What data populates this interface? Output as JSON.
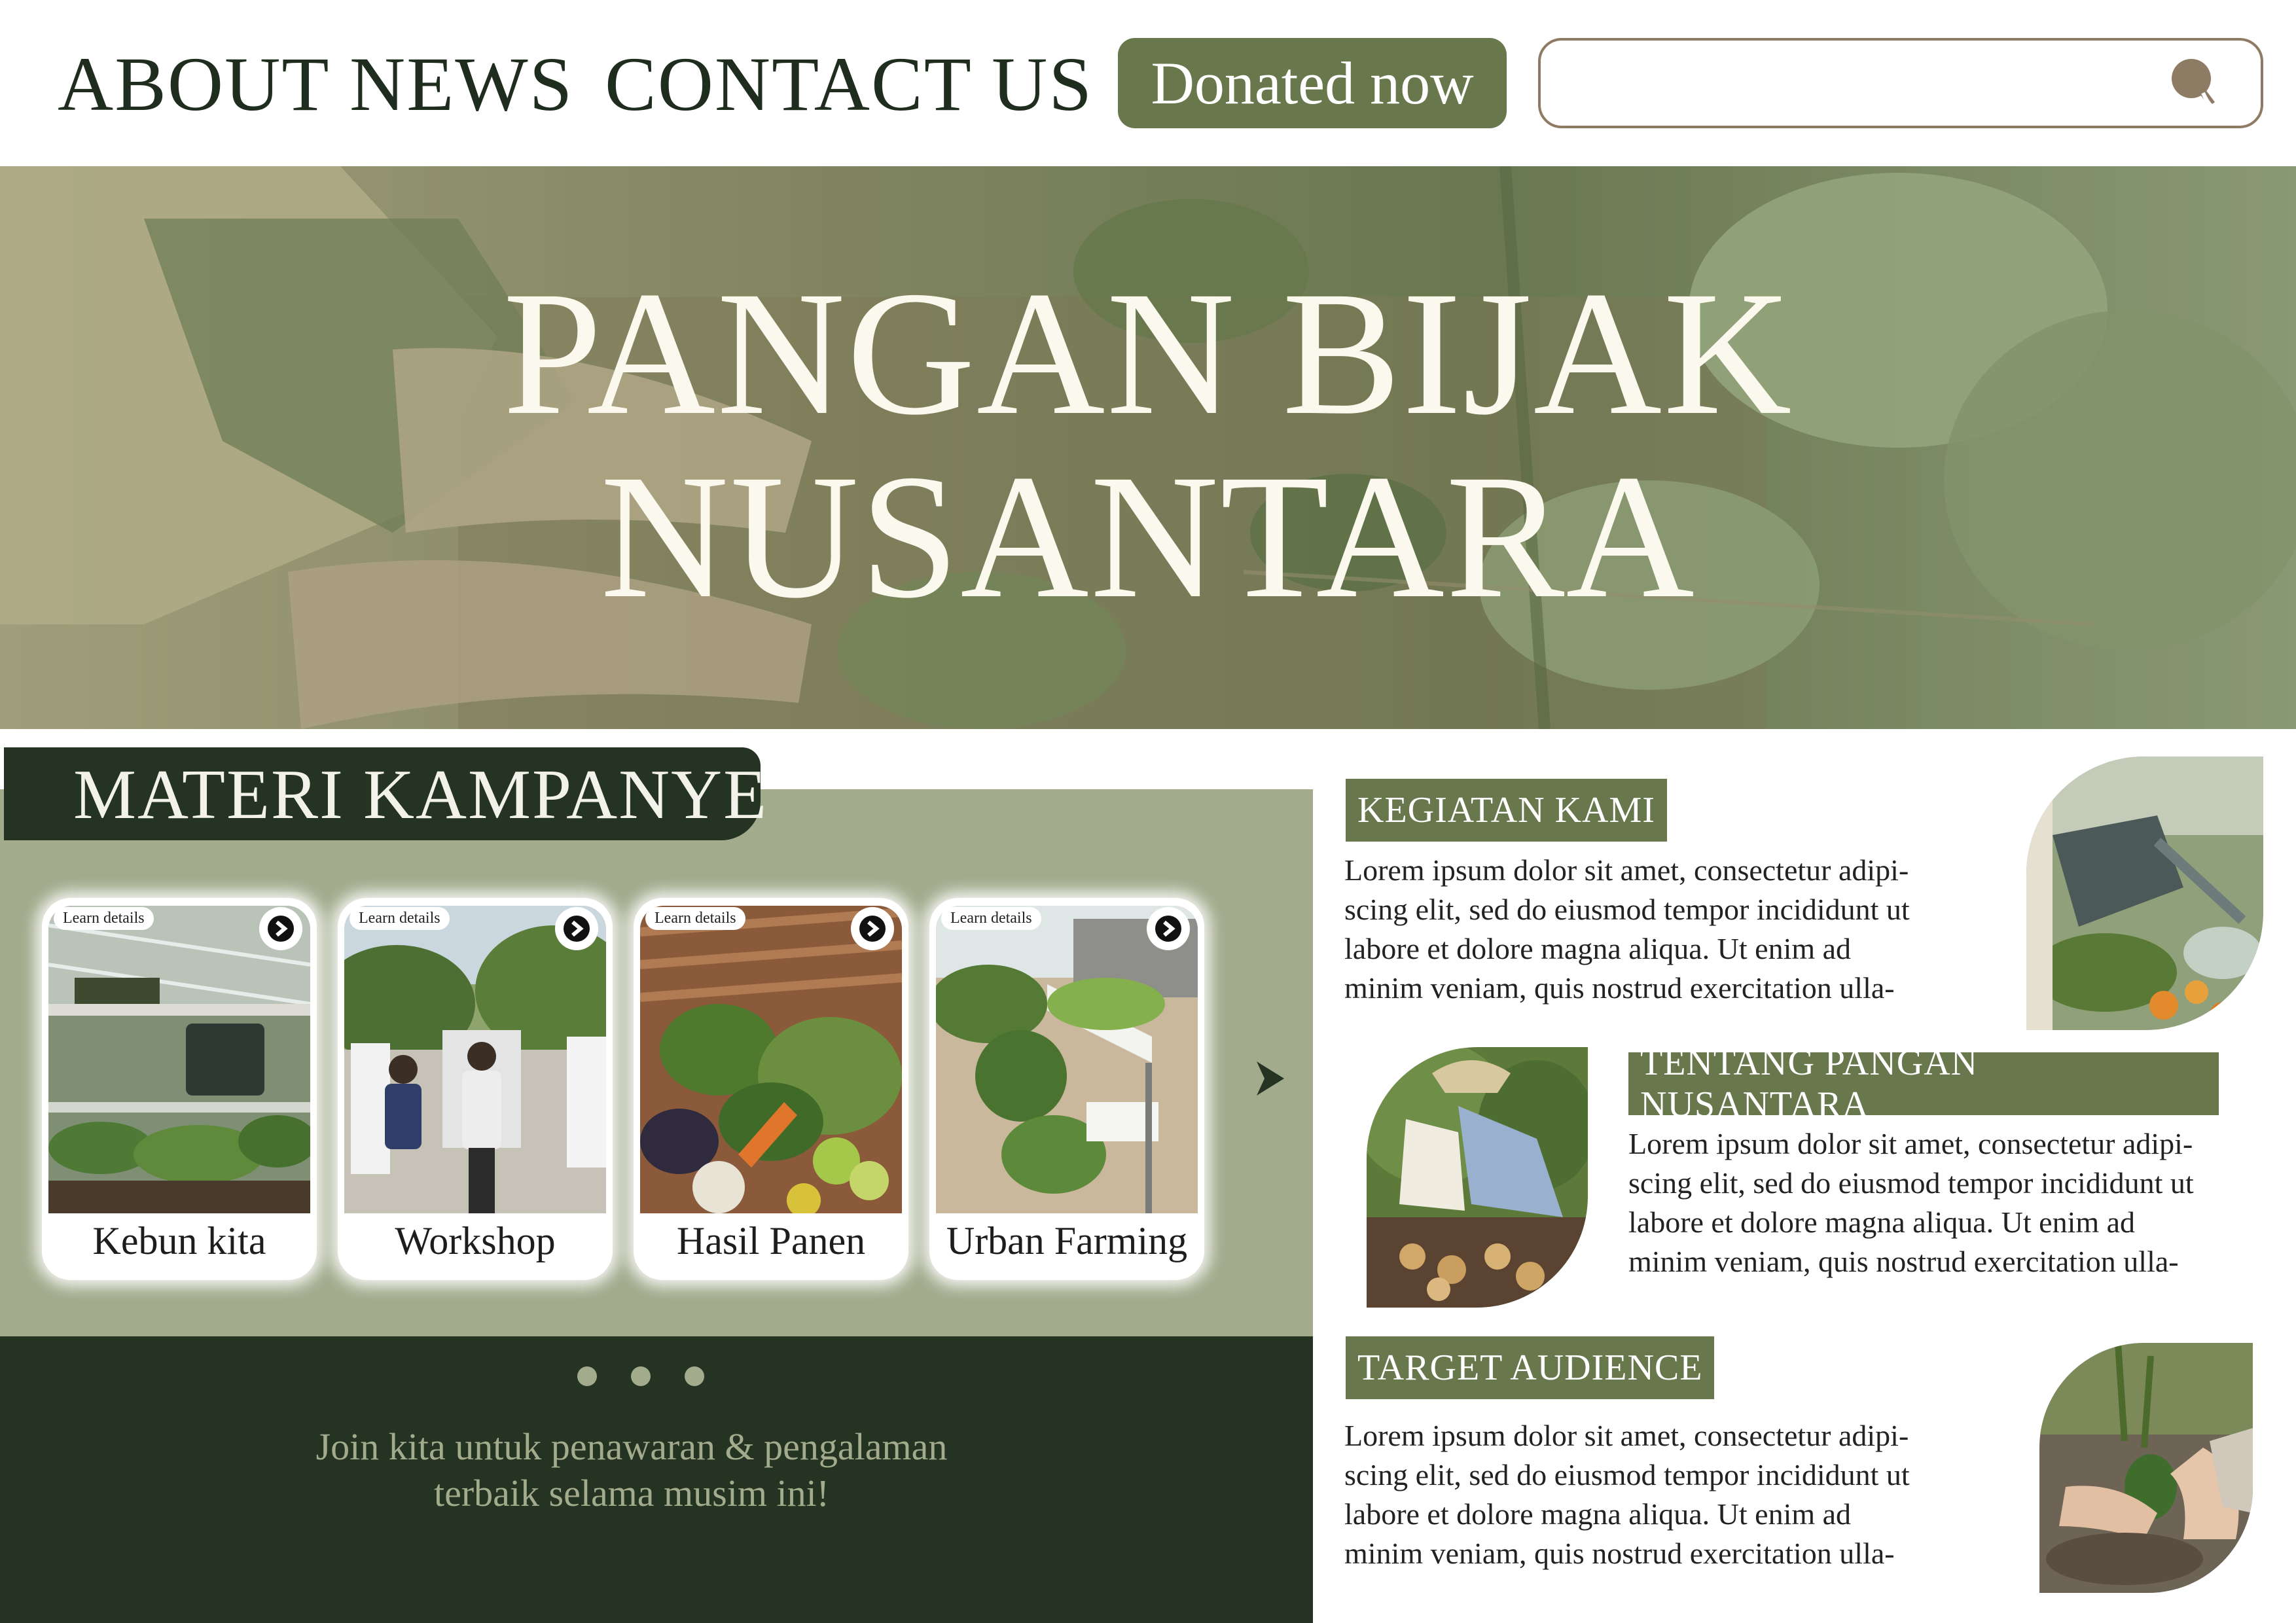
{
  "header": {
    "nav": [
      "ABOUT",
      "NEWS",
      "CONTACT US"
    ],
    "donate_label": "Donated now",
    "search": {
      "value": "",
      "placeholder": ""
    }
  },
  "hero": {
    "title_line1": "PANGAN BIJAK",
    "title_line2": "NUSANTARA"
  },
  "materi": {
    "title": "MATERI KAMPANYE",
    "cards": [
      {
        "pill": "Learn details",
        "label": "Kebun kita"
      },
      {
        "pill": "Learn details",
        "label": "Workshop"
      },
      {
        "pill": "Learn details",
        "label": "Hasil Panen"
      },
      {
        "pill": "Learn details",
        "label": "Urban Farming"
      }
    ],
    "join_line1": "Join kita untuk penawaran & pengalaman",
    "join_line2": "terbaik selama musim ini!"
  },
  "sections": [
    {
      "tag": "KEGIATAN KAMI",
      "lines": [
        "Lorem ipsum dolor sit amet, consectetur adipi-",
        "scing elit, sed do eiusmod tempor incididunt ut",
        "labore et dolore magna aliqua. Ut enim ad",
        "minim veniam, quis nostrud exercitation ulla-"
      ]
    },
    {
      "tag": "TENTANG PANGAN NUSANTARA",
      "lines": [
        "Lorem ipsum dolor sit amet, consectetur adipi-",
        "scing elit, sed do eiusmod tempor incididunt ut",
        "labore et dolore magna aliqua. Ut enim ad",
        "minim veniam, quis nostrud exercitation ulla-"
      ]
    },
    {
      "tag": "TARGET AUDIENCE",
      "lines": [
        "Lorem ipsum dolor sit amet, consectetur adipi-",
        "scing elit, sed do eiusmod tempor incididunt ut",
        "labore et dolore magna aliqua. Ut enim ad",
        "minim veniam, quis nostrud exercitation ulla-"
      ]
    }
  ],
  "colors": {
    "primary_green": "#68784c",
    "dark_green": "#253322",
    "sage": "#a3ab8d",
    "search_border": "#8d7c63"
  },
  "icons": [
    "search-icon",
    "chevron-right-icon"
  ]
}
